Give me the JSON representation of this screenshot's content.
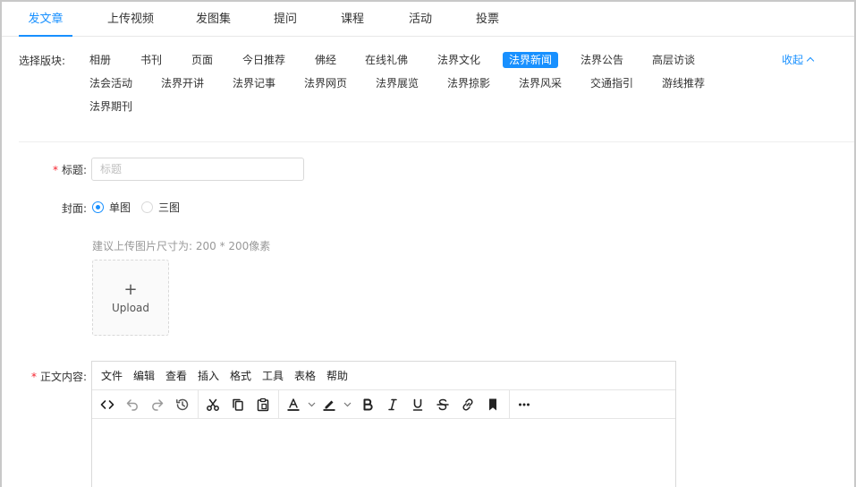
{
  "tabs": [
    {
      "label": "发文章",
      "active": true
    },
    {
      "label": "上传视频"
    },
    {
      "label": "发图集"
    },
    {
      "label": "提问"
    },
    {
      "label": "课程"
    },
    {
      "label": "活动"
    },
    {
      "label": "投票"
    }
  ],
  "section": {
    "label": "选择版块:",
    "collapse_label": "收起",
    "items": [
      "相册",
      "书刊",
      "页面",
      "今日推荐",
      "佛经",
      "在线礼佛",
      "法界文化",
      "法界新闻",
      "法界公告",
      "高层访谈",
      "法会活动",
      "法界开讲",
      "法界记事",
      "法界网页",
      "法界展览",
      "法界掠影",
      "法界风采",
      "交通指引",
      "游线推荐",
      "法界期刊"
    ],
    "active_item": "法界新闻"
  },
  "form": {
    "required_mark": "*",
    "title_label": "标题:",
    "title_placeholder": "标题",
    "cover_label": "封面:",
    "cover_options": [
      "单图",
      "三图"
    ],
    "cover_selected": "单图",
    "upload_hint": "建议上传图片尺寸为: 200 * 200像素",
    "upload_plus": "+",
    "upload_text": "Upload",
    "content_label": "正文内容:"
  },
  "editor": {
    "menu": [
      "文件",
      "编辑",
      "查看",
      "插入",
      "格式",
      "工具",
      "表格",
      "帮助"
    ],
    "toolbar_icons": [
      "source-code-icon",
      "undo-icon",
      "redo-icon",
      "history-icon",
      "cut-icon",
      "copy-icon",
      "paste-icon",
      "text-color-icon",
      "highlight-color-icon",
      "bold-icon",
      "italic-icon",
      "underline-icon",
      "strikethrough-icon",
      "link-icon",
      "bookmark-icon",
      "more-icon"
    ],
    "text_color": "#333333",
    "highlight_color": "#333333"
  },
  "colors": {
    "accent": "#1890ff",
    "required": "#f5222d"
  }
}
